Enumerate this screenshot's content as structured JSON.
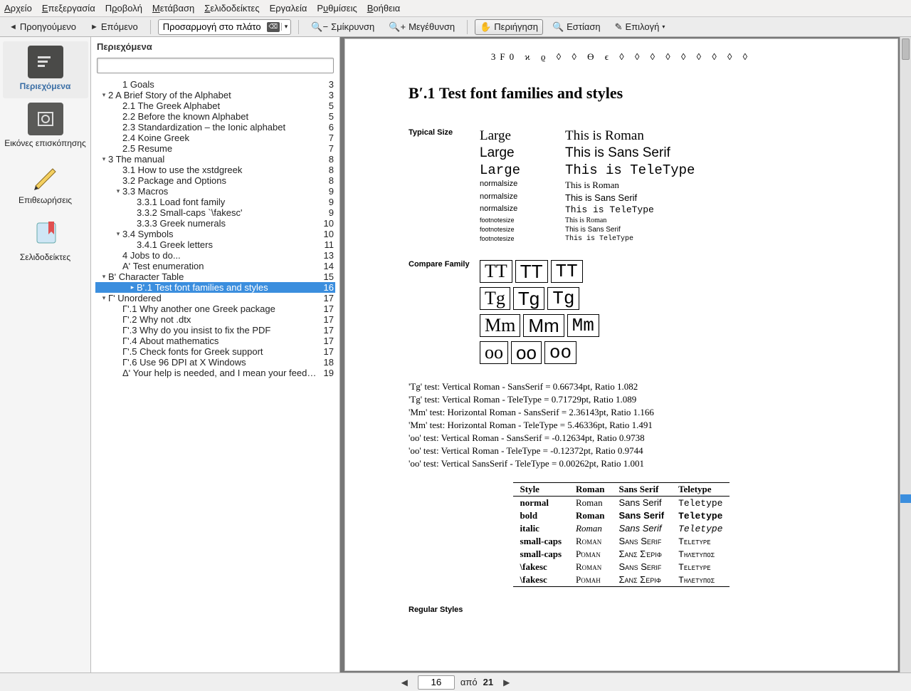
{
  "menu": {
    "file": "Αρχείο",
    "edit": "Επεξεργασία",
    "view": "Προβολή",
    "go": "Μετάβαση",
    "bookmarks": "Σελιδοδείκτες",
    "tools": "Εργαλεία",
    "settings": "Ρυθμίσεις",
    "help": "Βοήθεια"
  },
  "toolbar": {
    "prev": "Προηγούμενο",
    "next": "Επόμενο",
    "zoom_combo": "Προσαρμογή στο πλάτος",
    "zoom_out": "Σμίκρυνση",
    "zoom_in": "Μεγέθυνση",
    "browse": "Περιήγηση",
    "focus": "Εστίαση",
    "select": "Επιλογή"
  },
  "side": {
    "contents": "Περιεχόμενα",
    "thumbnails": "Εικόνες επισκόπησης",
    "reviews": "Επιθεωρήσεις",
    "bookmarks": "Σελιδοδείκτες"
  },
  "toc": {
    "header": "Περιεχόμενα",
    "items": [
      {
        "d": 1,
        "e": "",
        "t": "1 Goals",
        "p": "3"
      },
      {
        "d": 0,
        "e": "v",
        "t": "2 A Brief Story of the Alphabet",
        "p": "3"
      },
      {
        "d": 1,
        "e": "",
        "t": "2.1 The Greek Alphabet",
        "p": "5"
      },
      {
        "d": 1,
        "e": "",
        "t": "2.2 Before the known Alphabet",
        "p": "5"
      },
      {
        "d": 1,
        "e": "",
        "t": "2.3 Standardization – the Ionic alphabet",
        "p": "6"
      },
      {
        "d": 1,
        "e": "",
        "t": "2.4 Koine Greek",
        "p": "7"
      },
      {
        "d": 1,
        "e": "",
        "t": "2.5 Resume",
        "p": "7"
      },
      {
        "d": 0,
        "e": "v",
        "t": "3 The manual",
        "p": "8"
      },
      {
        "d": 1,
        "e": "",
        "t": "3.1 How to use the xstdgreek",
        "p": "8"
      },
      {
        "d": 1,
        "e": "",
        "t": "3.2 Package and Options",
        "p": "8"
      },
      {
        "d": 1,
        "e": "v",
        "t": "3.3 Macros",
        "p": "9"
      },
      {
        "d": 2,
        "e": "",
        "t": "3.3.1 Load font family",
        "p": "9"
      },
      {
        "d": 2,
        "e": "",
        "t": "3.3.2 Small-caps `\\fakesc'",
        "p": "9"
      },
      {
        "d": 2,
        "e": "",
        "t": "3.3.3 Greek numerals",
        "p": "10"
      },
      {
        "d": 1,
        "e": "v",
        "t": "3.4 Symbols",
        "p": "10"
      },
      {
        "d": 2,
        "e": "",
        "t": "3.4.1 Greek letters",
        "p": "11"
      },
      {
        "d": 1,
        "e": "",
        "t": "4 Jobs to do...",
        "p": "13"
      },
      {
        "d": 1,
        "e": "",
        "t": "Αʹ Test enumeration",
        "p": "14"
      },
      {
        "d": 0,
        "e": "v",
        "t": "Βʹ Character Table",
        "p": "15"
      },
      {
        "d": 2,
        "e": ">",
        "t": "Βʹ.1 Test font families and styles",
        "p": "16",
        "sel": true
      },
      {
        "d": 0,
        "e": "v",
        "t": "Γʹ Unordered",
        "p": "17"
      },
      {
        "d": 1,
        "e": "",
        "t": "Γʹ.1 Why another one Greek package",
        "p": "17"
      },
      {
        "d": 1,
        "e": "",
        "t": "Γʹ.2 Why not .dtx",
        "p": "17"
      },
      {
        "d": 1,
        "e": "",
        "t": "Γʹ.3 Why do you insist to fix the PDF",
        "p": "17"
      },
      {
        "d": 1,
        "e": "",
        "t": "Γʹ.4 About mathematics",
        "p": "17"
      },
      {
        "d": 1,
        "e": "",
        "t": "Γʹ.5 Check fonts for Greek support",
        "p": "17"
      },
      {
        "d": 1,
        "e": "",
        "t": "Γʹ.6 Use 96 DPI at X Windows",
        "p": "18"
      },
      {
        "d": 1,
        "e": "",
        "t": "Δʹ Your help is needed, and I mean your feedback",
        "p": "19"
      }
    ]
  },
  "doc": {
    "chars": "3F0   ϰ   ϱ   ◊   ◊   ϴ   ϵ   ◊   ◊   ◊   ◊   ◊   ◊   ◊   ◊   ◊",
    "heading": "Βʹ.1    Test font families and styles",
    "labels": {
      "typical": "Typical Size",
      "compare": "Compare Family",
      "regular": "Regular Styles"
    },
    "sizes": [
      {
        "s": "lg",
        "l": "Large",
        "t": "This is Roman",
        "f": ""
      },
      {
        "s": "lg",
        "l": "Large",
        "t": "This is Sans Serif",
        "f": "sans"
      },
      {
        "s": "lg",
        "l": "Large",
        "t": "This is TeleType",
        "f": "mono"
      },
      {
        "s": "ns",
        "l": "normalsize",
        "t": "This is Roman",
        "f": ""
      },
      {
        "s": "ns",
        "l": "normalsize",
        "t": "This is Sans Serif",
        "f": "sans"
      },
      {
        "s": "ns",
        "l": "normalsize",
        "t": "This is TeleType",
        "f": "mono"
      },
      {
        "s": "fs",
        "l": "footnotesize",
        "t": "This is Roman",
        "f": ""
      },
      {
        "s": "fs",
        "l": "footnotesize",
        "t": "This is Sans Serif",
        "f": "sans"
      },
      {
        "s": "fs",
        "l": "footnotesize",
        "t": "This is TeleType",
        "f": "mono"
      }
    ],
    "compare": [
      [
        "TT",
        "TT",
        "TT"
      ],
      [
        "Tg",
        "Tg",
        "Tg"
      ],
      [
        "Mm",
        "Mm",
        "Mm"
      ],
      [
        "oo",
        "oo",
        "oo"
      ]
    ],
    "tests": [
      "'Tg' test: Vertical Roman - SansSerif = 0.66734pt, Ratio 1.082",
      "'Tg' test: Vertical Roman - TeleType = 0.71729pt, Ratio 1.089",
      "'Mm' test: Horizontal Roman - SansSerif = 2.36143pt, Ratio 1.166",
      "'Mm' test: Horizontal Roman - TeleType = 5.46336pt, Ratio 1.491",
      "'oo' test: Vertical Roman - SansSerif = -0.12634pt, Ratio 0.9738",
      "'oo' test: Vertical Roman - TeleType = -0.12372pt, Ratio 0.9744",
      "'oo' test: Vertical SansSerif - TeleType = 0.00262pt, Ratio 1.001"
    ],
    "table": {
      "head": [
        "Style",
        "Roman",
        "Sans Serif",
        "Teletype"
      ],
      "rows": [
        {
          "style": "normal",
          "r": "Roman",
          "s": "Sans Serif",
          "t": "Teletype",
          "fmt": ""
        },
        {
          "style": "bold",
          "r": "Roman",
          "s": "Sans Serif",
          "t": "Teletype",
          "fmt": "b"
        },
        {
          "style": "italic",
          "r": "Roman",
          "s": "Sans Serif",
          "t": "Teletype",
          "fmt": "i"
        },
        {
          "style": "small-caps",
          "r": "Roman",
          "s": "Sans Serif",
          "t": "Teletype",
          "fmt": "sc"
        },
        {
          "style": "small-caps",
          "r": "Ρόμαν",
          "s": "Σανς Σέριφ",
          "t": "Τηλέτυπος",
          "fmt": "sc"
        },
        {
          "style": "\\fakesc",
          "r": "Roman",
          "s": "Sans Serif",
          "t": "Teletype",
          "fmt": "sc"
        },
        {
          "style": "\\fakesc",
          "r": "Ροман",
          "s": "Σανσ Σεριφ",
          "t": "Τηλετυποσ",
          "fmt": "sc"
        }
      ]
    }
  },
  "status": {
    "page": "16",
    "of_label": "από",
    "total": "21"
  }
}
